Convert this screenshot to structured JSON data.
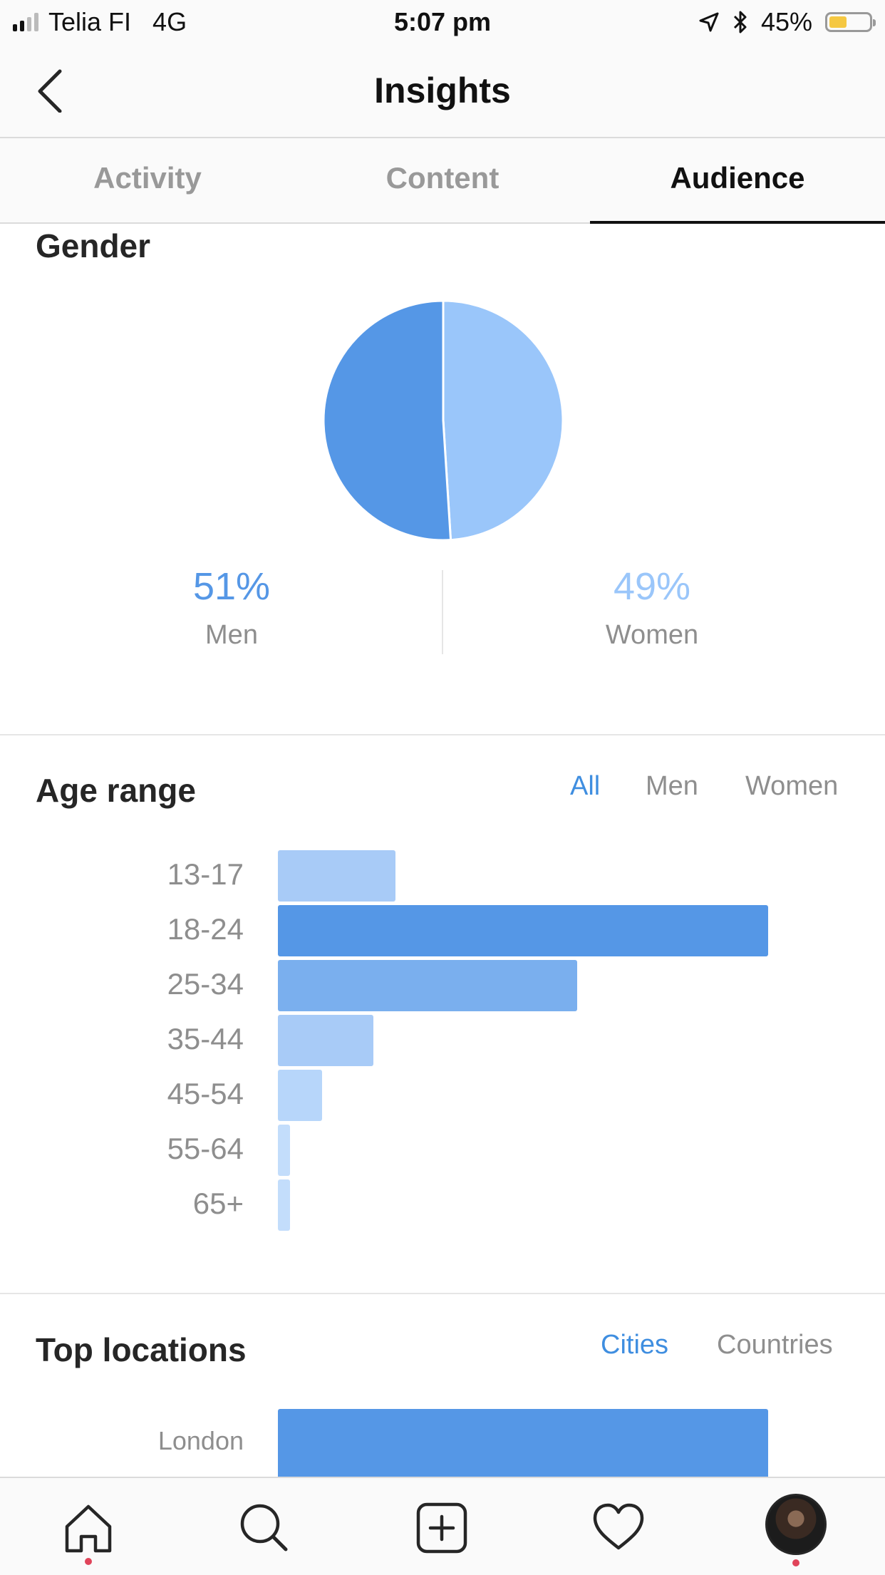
{
  "status_bar": {
    "carrier": "Telia FI",
    "network": "4G",
    "time": "5:07 pm",
    "battery": "45%",
    "battery_level": 0.45,
    "icons": [
      "signal-icon",
      "location-arrow-icon",
      "bluetooth-icon",
      "battery-icon"
    ]
  },
  "nav": {
    "title": "Insights",
    "back_icon": "chevron-left-icon"
  },
  "tabs": [
    {
      "label": "Activity",
      "active": false
    },
    {
      "label": "Content",
      "active": false
    },
    {
      "label": "Audience",
      "active": true
    }
  ],
  "gender": {
    "title": "Gender",
    "men_pct": "51%",
    "men_label": "Men",
    "women_pct": "49%",
    "women_label": "Women",
    "men_value": 51,
    "women_value": 49,
    "colors": {
      "men": "#5597e6",
      "women": "#9ac6fa"
    }
  },
  "age_range": {
    "title": "Age range",
    "filters": [
      {
        "label": "All",
        "active": true
      },
      {
        "label": "Men",
        "active": false
      },
      {
        "label": "Women",
        "active": false
      }
    ],
    "groups": [
      {
        "label": "13-17",
        "value": 24
      },
      {
        "label": "18-24",
        "value": 100
      },
      {
        "label": "25-34",
        "value": 61
      },
      {
        "label": "35-44",
        "value": 19.5
      },
      {
        "label": "45-54",
        "value": 9
      },
      {
        "label": "55-64",
        "value": 2.5
      },
      {
        "label": "65+",
        "value": 2.5
      }
    ]
  },
  "top_locations": {
    "title": "Top locations",
    "filters": [
      {
        "label": "Cities",
        "active": true
      },
      {
        "label": "Countries",
        "active": false
      }
    ],
    "rows": [
      {
        "label": "London",
        "value": 100
      }
    ]
  },
  "tab_bar": {
    "icons": [
      "home-icon",
      "search-icon",
      "add-post-icon",
      "heart-icon",
      "profile-avatar"
    ]
  }
}
